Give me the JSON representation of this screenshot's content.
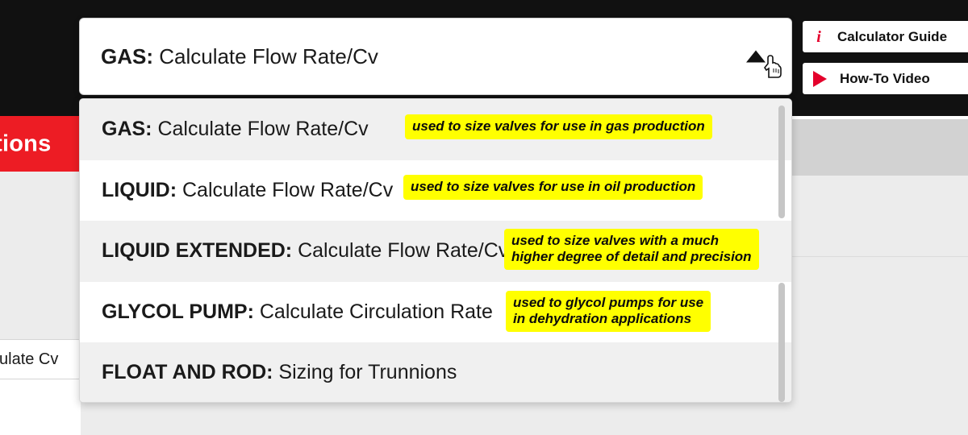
{
  "background": {
    "banner_text": "Conditions",
    "partial_field_label": "Calculate Cv",
    "colors": {
      "header": "#111111",
      "banner_red": "#ed1c24",
      "gray_band": "#d2d2d2",
      "body": "#ececec"
    }
  },
  "side_buttons": [
    {
      "icon": "info-icon",
      "label": "Calculator Guide"
    },
    {
      "icon": "play-icon",
      "label": "How-To Video"
    }
  ],
  "combobox": {
    "selected_prefix": "GAS:",
    "selected_text": " Calculate Flow Rate/Cv",
    "arrow_icon": "chevron-up-icon",
    "cursor_icon": "pointing-hand-cursor",
    "expanded": true
  },
  "dropdown": {
    "options": [
      {
        "prefix": "GAS:",
        "text": " Calculate Flow Rate/Cv",
        "note": "used to size valves for use in gas production",
        "highlighted": true
      },
      {
        "prefix": "LIQUID:",
        "text": " Calculate Flow Rate/Cv",
        "note": "used to size valves for use in oil production",
        "highlighted": false
      },
      {
        "prefix": "LIQUID EXTENDED:",
        "text": " Calculate Flow Rate/Cv",
        "note": "used to size valves with a much\nhigher degree of detail and precision",
        "highlighted": true
      },
      {
        "prefix": "GLYCOL PUMP:",
        "text": " Calculate Circulation Rate",
        "note": "used to glycol pumps for use\nin dehydration applications",
        "highlighted": false
      },
      {
        "prefix": "FLOAT AND ROD:",
        "text": " Sizing for Trunnions",
        "note": "",
        "highlighted": true
      }
    ],
    "note_background": "#ffff00",
    "scrollbar_visible": true
  }
}
